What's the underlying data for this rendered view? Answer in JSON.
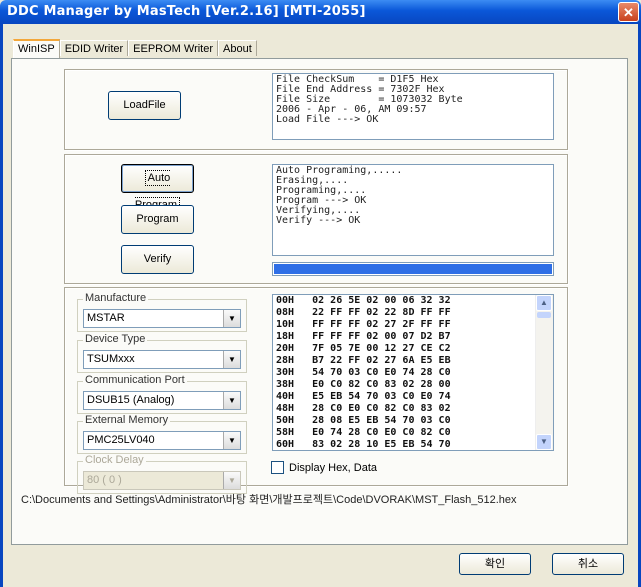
{
  "window": {
    "title": "DDC Manager  by MasTech  [Ver.2.16]  [MTI-2055]",
    "close_glyph": "✕"
  },
  "tabs": [
    {
      "label": "WinISP",
      "active": true
    },
    {
      "label": "EDID Writer"
    },
    {
      "label": "EEPROM Writer"
    },
    {
      "label": "About"
    }
  ],
  "load": {
    "button": "LoadFile",
    "info": "File CheckSum    = D1F5 Hex\nFile End Address = 7302F Hex\nFile Size        = 1073032 Byte\n2006 - Apr - 06, AM 09:57\nLoad File ---> OK"
  },
  "program": {
    "auto_button": "Auto Program",
    "program_button": "Program",
    "verify_button": "Verify",
    "log": "Auto Programing,.....\nErasing,....\nPrograming,....\nProgram ---> OK\nVerifying,....\nVerify ---> OK",
    "progress_percent": 100
  },
  "settings": {
    "manufacture": {
      "label": "Manufacture",
      "value": "MSTAR"
    },
    "device_type": {
      "label": "Device Type",
      "value": "TSUMxxx"
    },
    "comm_port": {
      "label": "Communication Port",
      "value": "DSUB15 (Analog)"
    },
    "ext_memory": {
      "label": "External Memory",
      "value": "PMC25LV040"
    },
    "clock_delay": {
      "label": "Clock Delay",
      "value": "80 ( 0 )"
    }
  },
  "hex_rows": [
    "00H   02 26 5E 02 00 06 32 32",
    "08H   22 FF FF 02 22 8D FF FF",
    "10H   FF FF FF 02 27 2F FF FF",
    "18H   FF FF FF 02 00 07 D2 B7",
    "20H   7F 05 7E 00 12 27 CE C2",
    "28H   B7 22 FF 02 27 6A E5 EB",
    "30H   54 70 03 C0 E0 74 28 C0",
    "38H   E0 C0 82 C0 83 02 28 00",
    "40H   E5 EB 54 70 03 C0 E0 74",
    "48H   28 C0 E0 C0 82 C0 83 02",
    "50H   28 08 E5 EB 54 70 03 C0",
    "58H   E0 74 28 C0 E0 C0 82 C0",
    "60H   83 02 28 10 E5 EB 54 70"
  ],
  "display_hex": {
    "label": "Display Hex, Data",
    "checked": false
  },
  "file_path": "C:\\Documents and Settings\\Administrator\\바탕 화면\\개발프로젝트\\Code\\DVORAK\\MST_Flash_512.hex",
  "dialog_buttons": {
    "ok": "확인",
    "cancel": "취소"
  },
  "scroll_glyphs": {
    "up": "▲",
    "down": "▼"
  }
}
